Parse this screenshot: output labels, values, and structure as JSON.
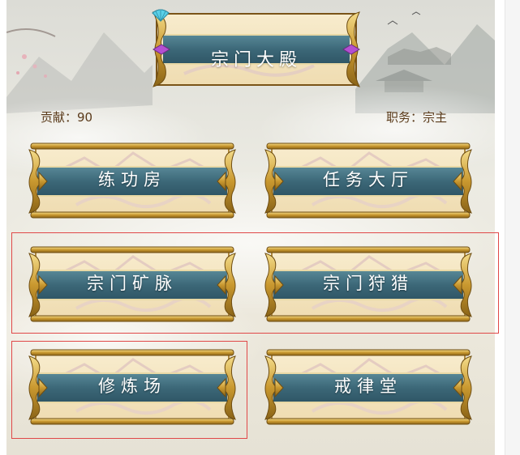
{
  "header": {
    "title": "宗门大殿"
  },
  "stats": {
    "contribution_label": "贡献：",
    "contribution_value": "90",
    "position_label": "职务：",
    "position_value": "宗主"
  },
  "halls": [
    {
      "label": "练功房"
    },
    {
      "label": "任务大厅"
    },
    {
      "label": "宗门矿脉"
    },
    {
      "label": "宗门狩猎"
    },
    {
      "label": "修炼场"
    },
    {
      "label": "戒律堂"
    }
  ],
  "colors": {
    "banner": "#3f6f7f",
    "parchment": "#f3e6c4",
    "gold": "#c8a048",
    "stat_text": "#5a3a1a",
    "highlight": "#e04848"
  },
  "icons": {
    "title_left": "fan-icon",
    "title_right": "fan-icon"
  }
}
